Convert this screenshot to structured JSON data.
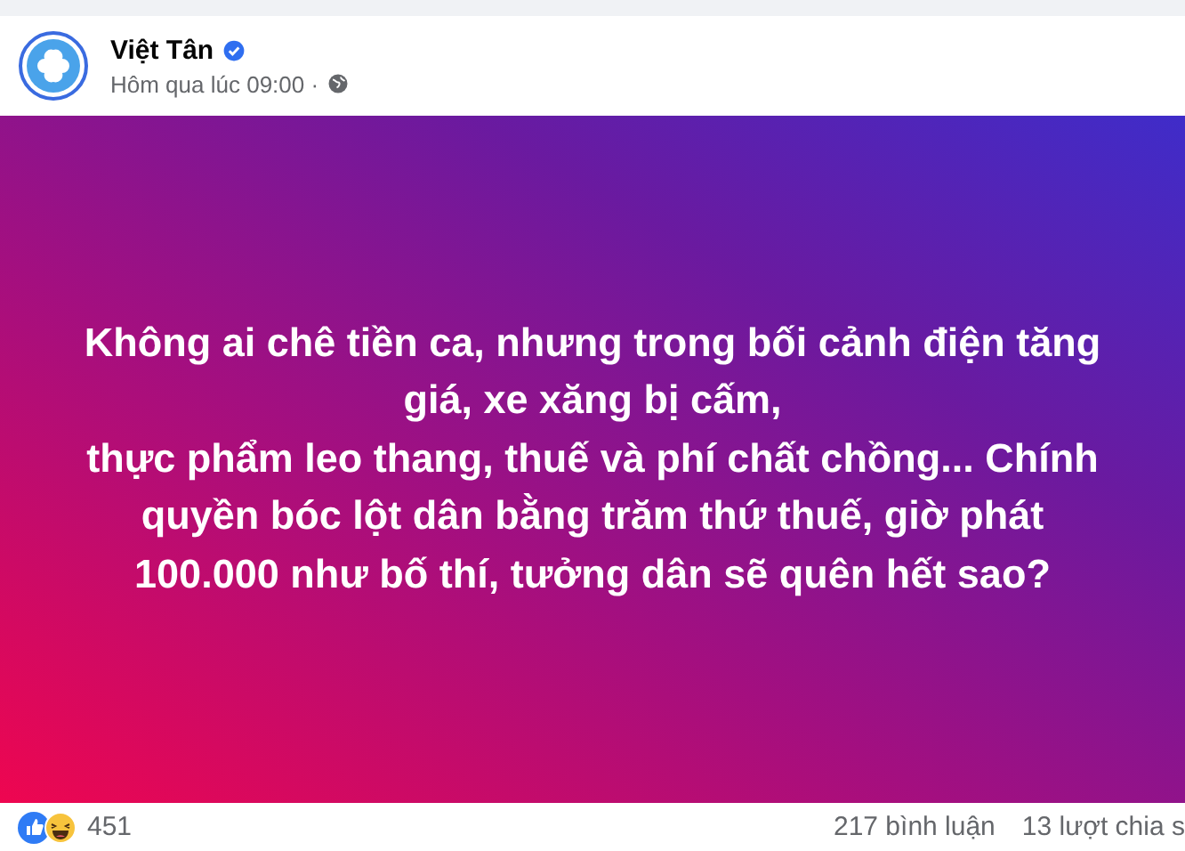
{
  "post": {
    "author": "Việt Tân",
    "verified": true,
    "time": "Hôm qua lúc 09:00 ·"
  },
  "post_image": {
    "lines": [
      "Không ai chê tiền ca, nhưng trong bối cảnh điện tăng",
      "giá, xe xăng bị cấm,",
      "thực phẩm leo thang, thuế và phí chất chồng... Chính",
      "quyền bóc lột dân bằng trăm thứ thuế, giờ phát",
      "100.000 như bố thí, tưởng dân sẽ quên hết sao?"
    ]
  },
  "footer": {
    "reactions": "451",
    "comments": "217 bình luận",
    "shares": "13 lượt chia s"
  }
}
